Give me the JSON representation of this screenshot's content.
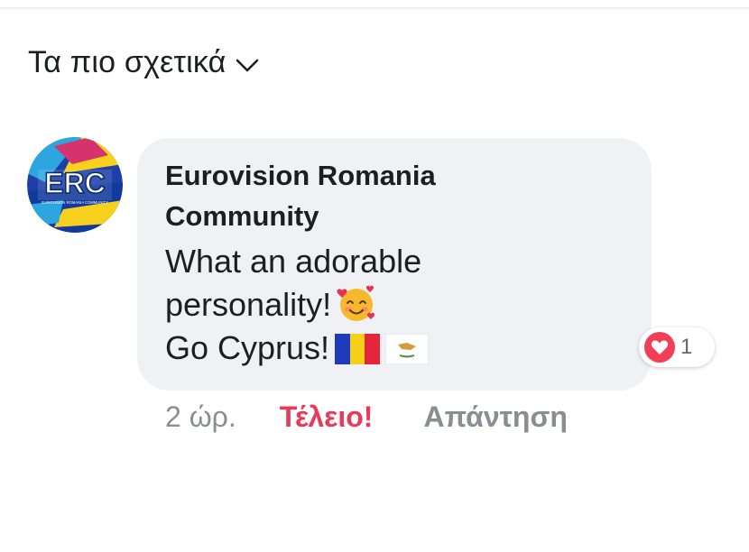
{
  "sort": {
    "label": "Τα πιο σχετικά",
    "icon": "chevron-down-icon"
  },
  "comment": {
    "avatar_logo_text": "ERC",
    "avatar_logo_subtext": "EUROVISION ROMANIA COMMUNITY",
    "author": "Eurovision Romania Community",
    "lines": [
      "What an adorable",
      "personality!",
      " Go Cyprus!"
    ],
    "emojis": [
      "smiling-face-with-hearts-icon",
      "romania-flag-icon",
      "cyprus-flag-icon"
    ],
    "reaction": {
      "icon": "heart-icon",
      "count": "1",
      "color": "#f33e58"
    },
    "actions": {
      "timestamp": "2 ώρ.",
      "like_label": "Τέλειο!",
      "reply_label": "Απάντηση"
    }
  },
  "colors": {
    "bubble": "#eff1f4",
    "text": "#1c1e21",
    "muted": "#8a8d91",
    "love": "#e83a58"
  }
}
